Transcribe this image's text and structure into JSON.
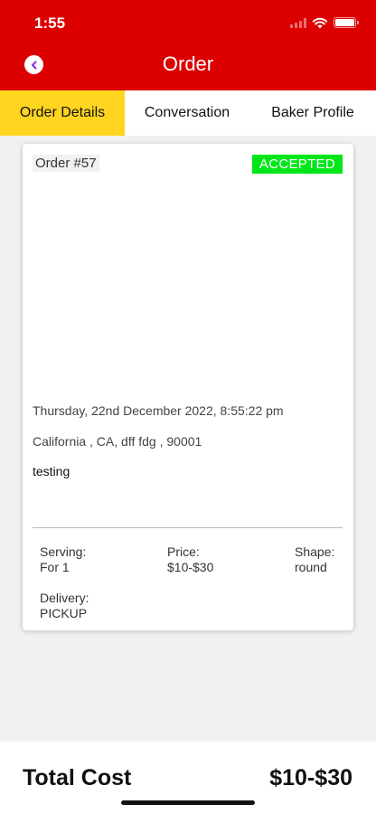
{
  "status_bar": {
    "time": "1:55"
  },
  "nav": {
    "title": "Order"
  },
  "tabs": [
    {
      "label": "Order Details",
      "active": true
    },
    {
      "label": "Conversation",
      "active": false
    },
    {
      "label": "Baker Profile",
      "active": false
    }
  ],
  "order": {
    "number": "Order #57",
    "status": "ACCEPTED",
    "date": "Thursday, 22nd December 2022, 8:55:22 pm",
    "address": "California , CA, dff fdg , 90001",
    "note": "testing",
    "serving_label": "Serving:",
    "serving_value": "For 1",
    "price_label": "Price:",
    "price_value": "$10-$30",
    "shape_label": "Shape:",
    "shape_value": "round",
    "delivery_label": "Delivery:",
    "delivery_value": "PICKUP"
  },
  "footer": {
    "total_label": "Total Cost",
    "total_value": "$10-$30"
  },
  "colors": {
    "header": "#dc0000",
    "active_tab": "#ffd51f",
    "status_badge": "#00e619",
    "back_icon": "#8a2be2"
  },
  "icons": {
    "back": "chevron-left-icon",
    "signal": "signal-icon",
    "wifi": "wifi-icon",
    "battery": "battery-icon"
  }
}
